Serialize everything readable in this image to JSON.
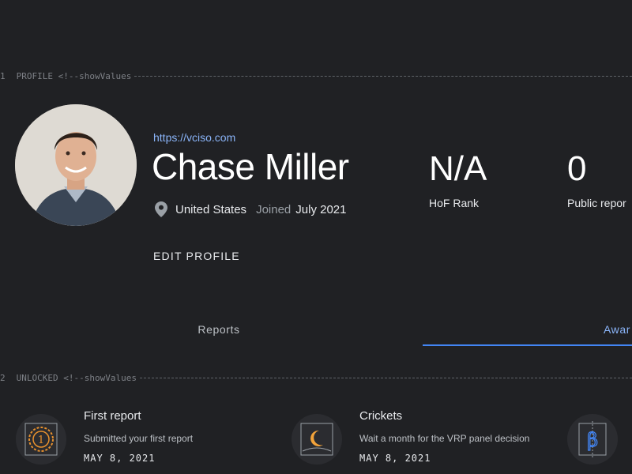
{
  "sections": {
    "profile": {
      "index": "1",
      "text": "PROFILE <!--showValues"
    },
    "unlocked": {
      "index": "2",
      "text": "UNLOCKED <!--showValues"
    }
  },
  "profile": {
    "avatar_icon": "person-avatar",
    "website": "https://vciso.com",
    "name": "Chase Miller",
    "location_icon": "map-pin-icon",
    "country": "United States",
    "joined_label": "Joined",
    "joined_date": "July 2021",
    "edit_label": "EDIT PROFILE"
  },
  "stats": [
    {
      "value": "N/A",
      "label": "HoF Rank"
    },
    {
      "value": "0",
      "label": "Public repor"
    }
  ],
  "tabs": [
    {
      "label": "Reports",
      "active": false
    },
    {
      "label": "Awar",
      "active": true
    }
  ],
  "awards": [
    {
      "icon": "medal-icon",
      "title": "First report",
      "description": "Submitted your first report",
      "date": "MAY 8, 2021",
      "color": "#e8912d"
    },
    {
      "icon": "crescent-moon-icon",
      "title": "Crickets",
      "description": "Wait a month for the VRP panel decision",
      "date": "MAY 8, 2021",
      "color": "#f2a33a"
    },
    {
      "icon": "beta-icon",
      "color": "#4285f4"
    }
  ],
  "colors": {
    "background": "#202124",
    "accent": "#8ab4f8",
    "indicator": "#4285f4"
  }
}
